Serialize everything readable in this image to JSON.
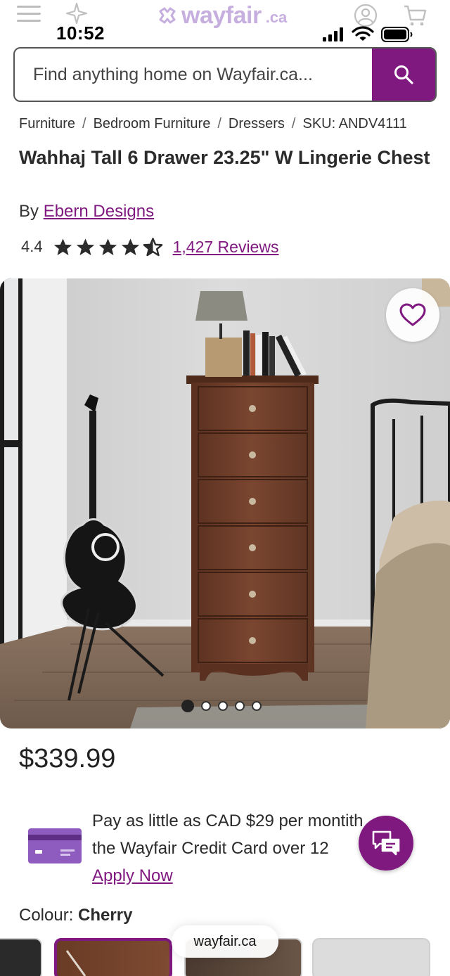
{
  "status_bar": {
    "time": "10:52"
  },
  "header": {
    "logo_text": "wayfair",
    "logo_suffix": ".ca",
    "brand_color": "#7f187f",
    "logo_color": "#c6aede"
  },
  "search": {
    "placeholder": "Find anything home on Wayfair.ca..."
  },
  "breadcrumb": [
    "Furniture",
    "Bedroom Furniture",
    "Dressers",
    "SKU: ANDV4111"
  ],
  "product": {
    "title": "Wahhaj Tall 6 Drawer 23.25\" W Lingerie Chest",
    "by_prefix": "By",
    "brand": "Ebern Designs",
    "rating": "4.4",
    "stars_shown": 4.5,
    "reviews": "1,427 Reviews",
    "price": "$339.99",
    "image_count": 5,
    "active_image_index": 0
  },
  "credit": {
    "line1": "Pay as little as CAD $29 per mont",
    "line1_tail": "ith",
    "line2": "the Wayfair Credit Card over 12 ",
    "line2_tail": ".",
    "apply": "Apply Now"
  },
  "colour": {
    "label": "Colour:",
    "selected": "Cherry"
  },
  "browser": {
    "url": "wayfair.ca"
  },
  "icons": [
    "menu-icon",
    "sparkle-icon",
    "account-icon",
    "cart-icon",
    "search-icon",
    "heart-icon",
    "chat-icon",
    "credit-card-icon",
    "star-icon"
  ]
}
